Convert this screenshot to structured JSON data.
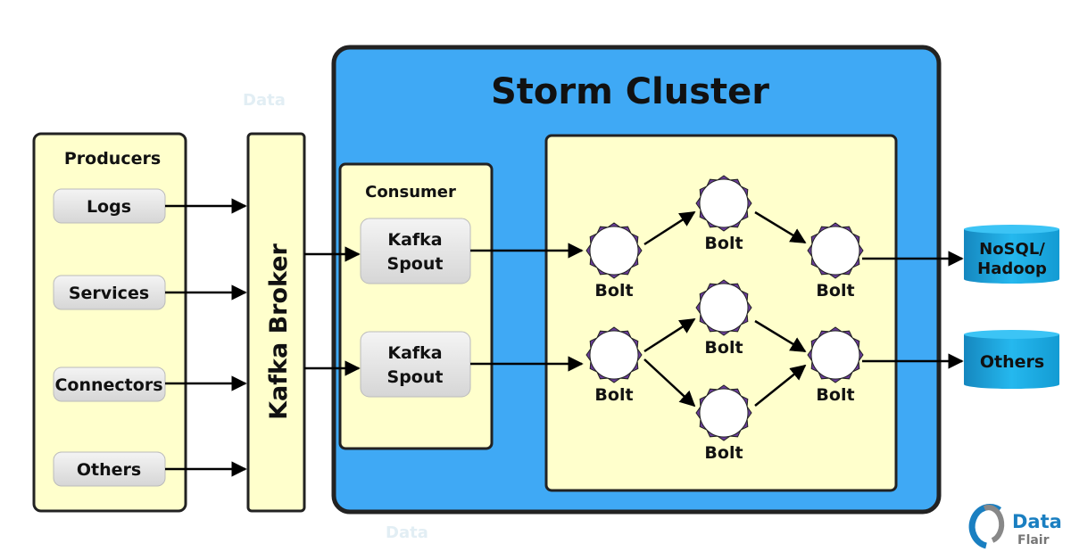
{
  "producers": {
    "title": "Producers",
    "items": [
      "Logs",
      "Services",
      "Connectors",
      "Others"
    ]
  },
  "broker": {
    "label": "Kafka Broker"
  },
  "cluster": {
    "title": "Storm Cluster",
    "consumer": {
      "title": "Consumer",
      "spouts": [
        "Kafka\nSpout",
        "Kafka\nSpout"
      ]
    },
    "bolts": [
      "Bolt",
      "Bolt",
      "Bolt",
      "Bolt",
      "Bolt",
      "Bolt",
      "Bolt"
    ]
  },
  "outputs": [
    {
      "line1": "NoSQL/",
      "line2": "Hadoop"
    },
    {
      "line1": "Others",
      "line2": ""
    }
  ],
  "logo": {
    "line1": "Data",
    "line2": "Flair"
  },
  "colors": {
    "cluster": "#3fa9f5",
    "box": "#ffffcc",
    "bolt": "#6a3d9a",
    "cylinder": "#1ea6dd",
    "logo": "#1a7fc1"
  },
  "icons": [
    "bolt-icon",
    "database-cylinder-icon",
    "dataflair-logo-icon"
  ]
}
